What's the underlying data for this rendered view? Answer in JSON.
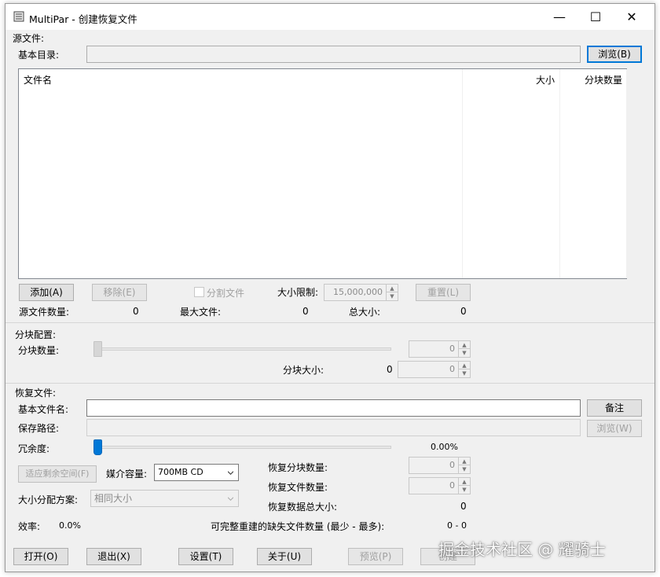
{
  "window": {
    "title": "MultiPar - 创建恢复文件",
    "controls": {
      "minimize": "—",
      "maximize": "☐",
      "close": "✕"
    }
  },
  "source": {
    "group_label": "源文件:",
    "base_dir_label": "基本目录:",
    "base_dir_value": "",
    "browse_label": "浏览(B)",
    "columns": [
      "文件名",
      "大小",
      "分块数量"
    ],
    "add_label": "添加(A)",
    "remove_label": "移除(E)",
    "split_label": "分割文件",
    "size_limit_label": "大小限制:",
    "size_limit_value": "15,000,000",
    "reset_label": "重置(L)",
    "count_label": "源文件数量:",
    "count_value": "0",
    "max_file_label": "最大文件:",
    "max_file_value": "0",
    "total_size_label": "总大小:",
    "total_size_value": "0"
  },
  "blocks": {
    "group_label": "分块配置:",
    "count_label": "分块数量:",
    "count_value": "0",
    "size_label": "分块大小:",
    "size_value_left": "0",
    "size_value": "0"
  },
  "recovery": {
    "group_label": "恢复文件:",
    "base_name_label": "基本文件名:",
    "base_name_value": "",
    "note_label": "备注",
    "save_path_label": "保存路径:",
    "save_path_value": "",
    "browse_label": "浏览(W)",
    "redundancy_label": "冗余度:",
    "redundancy_value": "0.00%",
    "redundancy_fraction": 0,
    "fit_free_label": "适应剩余空间(F)",
    "media_label": "媒介容量:",
    "media_value": "700MB CD",
    "alloc_label": "大小分配方案:",
    "alloc_value": "相同大小",
    "rec_blocks_label": "恢复分块数量:",
    "rec_blocks_value": "0",
    "rec_files_label": "恢复文件数量:",
    "rec_files_value": "0",
    "rec_total_label": "恢复数据总大小:",
    "rec_total_value": "0",
    "efficiency_label": "效率:",
    "efficiency_value": "0.0%",
    "missing_label": "可完整重建的缺失文件数量 (最少 - 最多):",
    "missing_value": "0 - 0"
  },
  "footer": {
    "open_label": "打开(O)",
    "exit_label": "退出(X)",
    "settings_label": "设置(T)",
    "about_label": "关于(U)",
    "preview_label": "预览(P)",
    "create_label": "创建"
  },
  "watermark": "掘金技术社区 @ 耀骑士",
  "colors": {
    "accent": "#0078d7",
    "window_bg": "#f0f0f0",
    "disabled_text": "#a0a0a0"
  }
}
